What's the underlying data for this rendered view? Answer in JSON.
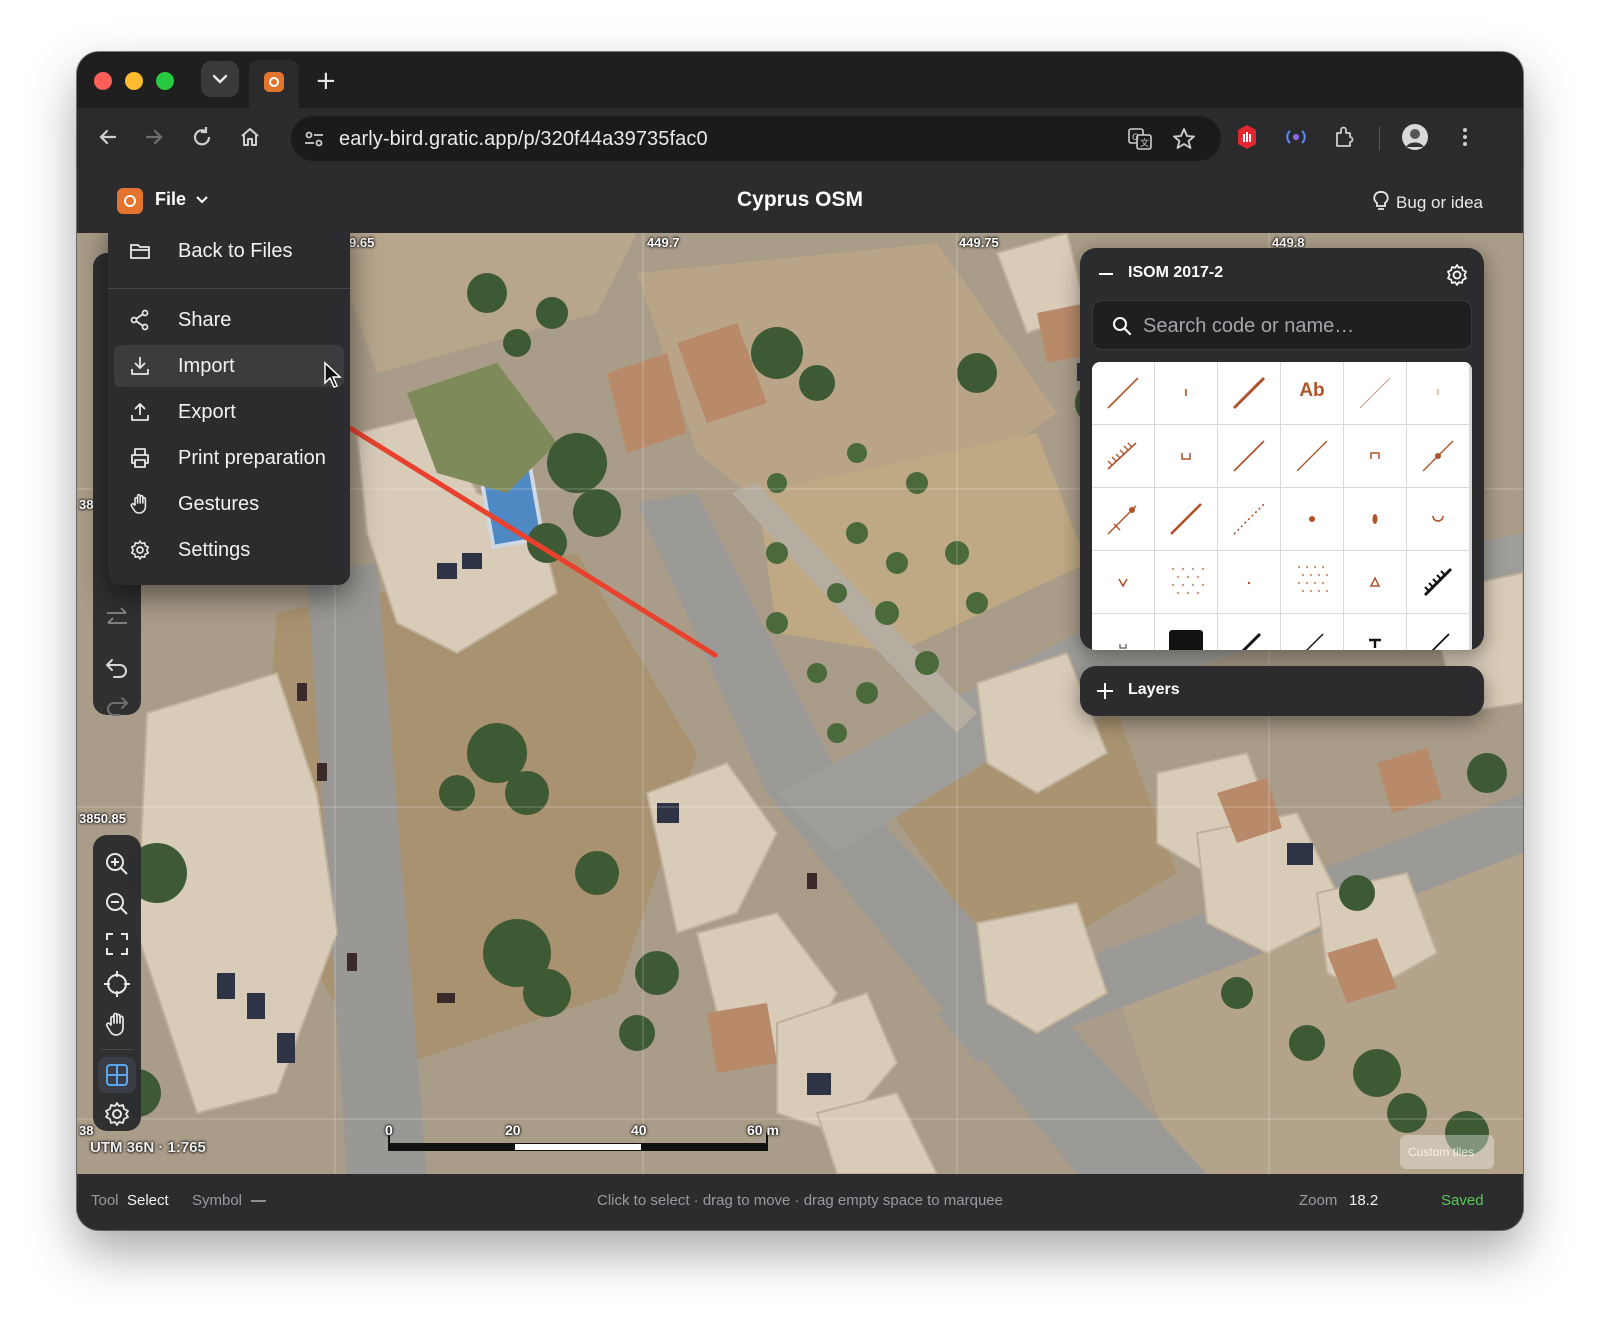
{
  "browser": {
    "url": "early-bird.gratic.app/p/320f44a39735fac0",
    "new_tab": "+"
  },
  "app": {
    "file_menu_label": "File",
    "title": "Cyprus OSM",
    "feedback_label": "Bug or idea"
  },
  "file_menu": {
    "items": [
      {
        "label": "Back to Files",
        "icon": "folder-icon"
      },
      {
        "label": "Share",
        "icon": "share-icon"
      },
      {
        "label": "Import",
        "icon": "download-icon"
      },
      {
        "label": "Export",
        "icon": "upload-icon"
      },
      {
        "label": "Print preparation",
        "icon": "printer-icon"
      },
      {
        "label": "Gestures",
        "icon": "hand-icon"
      },
      {
        "label": "Settings",
        "icon": "gear-icon"
      }
    ],
    "hovered_item": "Import"
  },
  "map": {
    "grid_labels": {
      "top": [
        "9.65",
        "449.7",
        "449.75",
        "449.8"
      ],
      "left": [
        "38",
        "3850.85",
        "38"
      ]
    },
    "scale_labels": [
      "0",
      "20",
      "40",
      "60 m"
    ],
    "projection": "UTM 36N · 1:765",
    "attribution": "Custom tiles"
  },
  "symbol_panel": {
    "title": "ISOM 2017-2",
    "search_placeholder": "Search code or name…",
    "text_symbol": "Ab",
    "symbol_color": "#b0532a"
  },
  "layers": {
    "label": "Layers"
  },
  "status_bar": {
    "tool_label": "Tool",
    "tool_value": "Select",
    "symbol_label": "Symbol",
    "symbol_value": "—",
    "hint": "Click to select · drag to move · drag empty space to marquee",
    "zoom_label": "Zoom",
    "zoom_value": "18.2",
    "save_state": "Saved"
  },
  "colors": {
    "accent": "#e2742e",
    "annotation_arrow": "#e8422f",
    "saved": "#5ac85a"
  }
}
